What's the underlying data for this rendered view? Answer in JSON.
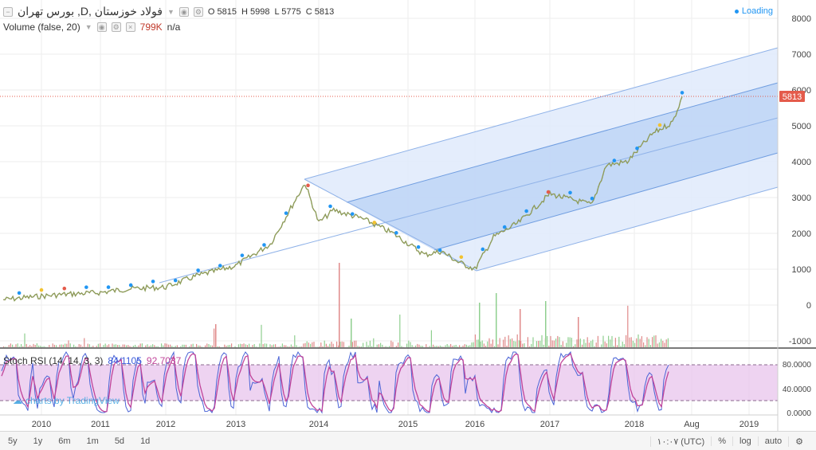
{
  "header": {
    "symbol": "بورس تهران ,D, فولاد خوزستان",
    "ohlc": {
      "o_label": "O",
      "o": "5815",
      "h_label": "H",
      "h": "5998",
      "l_label": "L",
      "l": "5775",
      "c_label": "C",
      "c": "5813"
    },
    "loading": "Loading"
  },
  "volume_legend": {
    "label": "Volume (false, 20)",
    "value": "799K",
    "extra": "n/a"
  },
  "stoch_legend": {
    "label": "Stoch RSI (14, 14, 3, 3)",
    "k": "84.1105",
    "d": "92.7037"
  },
  "price_axis": {
    "ticks": [
      "8000",
      "7000",
      "6000",
      "5000",
      "4000",
      "3000",
      "2000",
      "1000",
      "0",
      "-1000"
    ],
    "last_price": "5813"
  },
  "stoch_axis": {
    "ticks": [
      "80.0000",
      "40.0000",
      "0.0000"
    ]
  },
  "time_axis": {
    "ticks": [
      "2010",
      "2011",
      "2012",
      "2013",
      "2014",
      "2015",
      "2016",
      "2017",
      "2018",
      "Aug",
      "2019"
    ]
  },
  "watermark": "charts by TradingView",
  "timeframes": [
    "5y",
    "1y",
    "6m",
    "1m",
    "5d",
    "1d"
  ],
  "bottom_right": {
    "time": "۱۰:۰۷ (UTC)",
    "percent": "%",
    "log": "log",
    "auto": "auto",
    "settings_icon": "gear-icon"
  },
  "colors": {
    "candle_up": "#8aa35a",
    "candle_down": "#b06060",
    "channel_fill": "#cfe0f8",
    "channel_inner": "#a8c6f0",
    "channel_line": "#6f9de0",
    "stoch_band": "#e3bfe6",
    "stoch_line": "#c0449a",
    "price_tag": "#e45b4b",
    "accent": "#2196f3"
  },
  "chart_data": [
    {
      "type": "line",
      "title": "بورس تهران ,D, فولاد خوزستان",
      "xlabel": "",
      "ylabel": "",
      "ylim": [
        -1000,
        8000
      ],
      "x": [
        "2009-06",
        "2010-01",
        "2010-06",
        "2011-01",
        "2011-06",
        "2012-01",
        "2012-06",
        "2013-01",
        "2013-06",
        "2013-11",
        "2014-01",
        "2014-03",
        "2014-07",
        "2014-11",
        "2015-04",
        "2015-07",
        "2015-10",
        "2016-01",
        "2016-04",
        "2016-08",
        "2017-01",
        "2017-03",
        "2017-07",
        "2017-09",
        "2017-12",
        "2018-03",
        "2018-05",
        "2018-06"
      ],
      "series": [
        {
          "values": [
            150,
            250,
            300,
            350,
            450,
            500,
            800,
            1100,
            1700,
            3400,
            2300,
            2650,
            2400,
            2000,
            1400,
            1500,
            1200,
            1000,
            1900,
            2300,
            3100,
            3000,
            2800,
            3900,
            4000,
            4800,
            5100,
            5813
          ]
        }
      ],
      "last_value": 5813
    },
    {
      "type": "bar",
      "title": "Volume (false, 20)",
      "values_note": "daily volume; last 799K"
    },
    {
      "type": "line",
      "title": "Stoch RSI (14, 14, 3, 3)",
      "ylim": [
        0,
        100
      ],
      "band": [
        20,
        80
      ],
      "series": [
        {
          "name": "K",
          "last": 84.1105
        },
        {
          "name": "D",
          "last": 92.7037
        }
      ]
    }
  ]
}
